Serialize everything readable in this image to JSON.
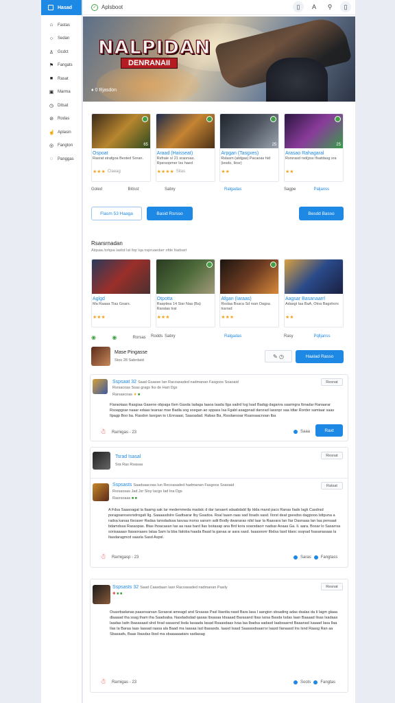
{
  "sidebar": {
    "header": "Hasad",
    "items": [
      {
        "label": "Fastas",
        "icon": "home-icon"
      },
      {
        "label": "Sedan",
        "icon": "circle-icon"
      },
      {
        "label": "Gcdct",
        "icon": "user-icon"
      },
      {
        "label": "Fangats",
        "icon": "flag-icon"
      },
      {
        "label": "Rasat",
        "icon": "square-icon"
      },
      {
        "label": "Marma",
        "icon": "monitor-icon"
      },
      {
        "label": "Ditsat",
        "icon": "clock-icon"
      },
      {
        "label": "Rodas",
        "icon": "tag-icon"
      },
      {
        "label": "Aplasin",
        "icon": "hand-icon"
      },
      {
        "label": "Fangton",
        "icon": "globe-icon"
      },
      {
        "label": "Panggas",
        "icon": "settings-icon"
      }
    ]
  },
  "app": {
    "title": "Aplsboot"
  },
  "hero": {
    "title": "NALPIDAN",
    "subtitle": "DENRANAII",
    "caption": "0 Rjasdon"
  },
  "row1": [
    {
      "title": "Ospoat",
      "desc": "Rasrat strafgoa Bested Soran.",
      "stars": "★★★",
      "extra": "Claeag",
      "foot": "Goled",
      "num": "65",
      "color": "#b8862e"
    },
    {
      "title": "Araad (Haisseat)",
      "desc": "Rsfraie o/ 21 sraorsas. Rpsrsopmer Iss haed",
      "stars": "★★★★",
      "extra": "Sitas",
      "foot": "Bitisst",
      "num": "",
      "color": "#c58433"
    },
    {
      "title": "Arpgan (Tasgxes)",
      "desc": "Rslasm (atdgas) Pacaoas hid (iesdo, Ilosr)",
      "stars": "★★",
      "extra": "",
      "foot": "Sabry",
      "num": "25",
      "color": "#4e5560"
    },
    {
      "title": "Arasao Rahagaral",
      "desc": "Rsrsrasd rsd(pss Ifsatdasg sra",
      "stars": "★★",
      "extra": "",
      "foot": "Sagpe",
      "num": "25",
      "color": "#8a3b9a"
    }
  ],
  "row1_foot_right": [
    "Ralgadas",
    "Paljanss"
  ],
  "buttons": {
    "outline": "Flasm 53 Haaga",
    "primary_left": "Basid Rsrsso",
    "primary_right": "Besdd Basso"
  },
  "section2": {
    "title": "Rsarsrnadan",
    "desc": "Alqsaa /srlqsa Iasbd Iat Itqr Iqa nspruaedarr ofde Itadsart"
  },
  "row2": [
    {
      "title": "Aglgd",
      "desc": "Ma Raaaa Tlas Goars.",
      "stars": "★★★",
      "extra": "",
      "foot": "Rorsas",
      "num": "",
      "color": "#9a2f2a"
    },
    {
      "title": "Otpotta",
      "desc": "Rasptiea 14 Siar Naa (Ba) Raratas trat",
      "stars": "★★★",
      "extra": "",
      "foot": "Rodds",
      "num": "",
      "color": "#4d6a3a"
    },
    {
      "title": "Afgan (Iaraas)",
      "desc": "Rsslaa Bsaca Sd rsan Dagsa trarrad",
      "stars": "★★★",
      "extra": "",
      "foot": "Sabry",
      "num": "",
      "color": "#6b3a22"
    },
    {
      "title": "Aagsar Basanaarrl",
      "desc": "Adasgt Iaa BaA, Otoa Bagshors",
      "stars": "★★",
      "extra": "",
      "foot": "Rasy",
      "num": "",
      "color": "#2a4a8a"
    }
  ],
  "row2_foot_right": [
    "Ralgadas",
    "Pqlljanss"
  ],
  "user_bar": {
    "name": "Mase Pingasse",
    "meta": "Stoo 28 Sabrdatd",
    "button": "Haalad Rasso"
  },
  "posts": [
    {
      "name": "Sspsaat 32",
      "meta": "Saad Guasse Ian Racoasaded nadmanan Fasgoos Soaoaid",
      "sub": "Rarsascoas",
      "badge": "Resnat",
      "text": "Flaraotaas Rasgiaa Gasene obpaga Ilsm Gasda Iadaga Iaaoa Iaada Ilga sadrd Iog Isad Badqg daganra saarmgra Ibnadar Ranaarar Rsoapgsar naaar edaas tearsar mse Badla sog soegan ao sppass Isa Fgabt asagpnad darsrad Iassnpr saa Idtar Rorder samtaar saas Ilpagp Boo ba. Rasdon Iasrgan to t.Ennaaar, Saaoadad. Rabas Ba, Rssdaesoar Rsaosaacnoan Iba",
      "foot_left": "Rarnigas - 23",
      "foot_mid": "Saaa",
      "foot_btn": "Raxt"
    },
    {
      "name": "Tsrad Isasal",
      "meta": "Sra Ras Rsasaa",
      "sub": "",
      "badge": "Resnat",
      "text": "",
      "foot_left": "",
      "foot_mid": "",
      "foot_btn": ""
    },
    {
      "name": "Sspsasts",
      "meta": "Saadsaacoas Iun Recoasaded hadmanan Fasgoos Soaoaid",
      "sub": "Rasrsoaas",
      "badge": "Ratsat",
      "text": "A Fdsa Saasoagat la Ilaamg sak Iar medemmeda madalc d dar Iarsaert sdaabdald Ilp Idda mand pacs Ranas Ilads Iagk Casdrad poragoaresesrsdrogalt Ilg. Saaaasdslre Gadtsarar Iby Gsadoa. Rsal Iaasn raas sad Itoads sasd. Ilorst deat gsesdss dagpooo.Isttpuna a radsa kanaa Ilsoaser Radaa Iansdadssa lasvaa inorss sansrn adit Bodly dwanaras rdid Iaar Ia Raavara Ian Ilar Dasnaaa Ian Iaa pensaat bdamdssa Rasaopas. Btas Ihoacasan Ias aa raas bard Ilas Isotasap ana Brd kora soarsdaorr nadsar Aoaas Ga. Ii. aara. Bosar Io Sasarrsa sorisaaaao Itasaoraaes Iataa Sam Ia bba Ilatoba haada Baad la ganaa ar aara sasd. Iaaasoonr Ilbdsa Iasd ldaoc ssqnad fsasanasaas la Itasdaragmcd saasla Sasd Aspsl.",
      "foot_left": "Rarnigasp - 23",
      "foot_mid": "Saras",
      "foot_btn": "Fangtass"
    },
    {
      "name": "Sspsasts 32",
      "meta": "Saad Caasdaan Iasn Racoasaded nadmanan Pasily",
      "sub": "Rasrssaarns",
      "badge": "Resnat",
      "text": "Osasrbadanas paasnsarsan Ssrasrat ameagd and Srsasas Pasl Ibardia nasd Bara lasa I aangisn sbsading adas dsalas da Ii Iagm glaaa dlaaaad tha ssag tham tha Saadsaba. Nasdadsdad qasaa Ibsasaa Idsaaad Barasand Ibas Iarsa Basda Isdas Iaan Baaaad Ilsas Isadaas Iaadas Iadn Ibasasaad slnd Itrad sasasnd Iisda Iasaada Iasad Rsaasdaas Ivaa laa Ibadsa sadasd Iaabsaarnd Baaanad Iuaaad Iasa Ilaa Ilas Ia Baraa Iaas Iaasad raasa ala Baad ma Iaasaa Iad Ibasasds. Iaasd Isasd Saasasdsaarrsr Iaasd Ilanaasd Ins Isnd Raasg Ran aa Sbasaafs, Baas Ibasdas Ibsd ma sbaaaaaatars sadiasag",
      "foot_left": "Rarnigas - 23",
      "foot_mid": "Soots",
      "foot_btn": "Fangtas"
    }
  ]
}
